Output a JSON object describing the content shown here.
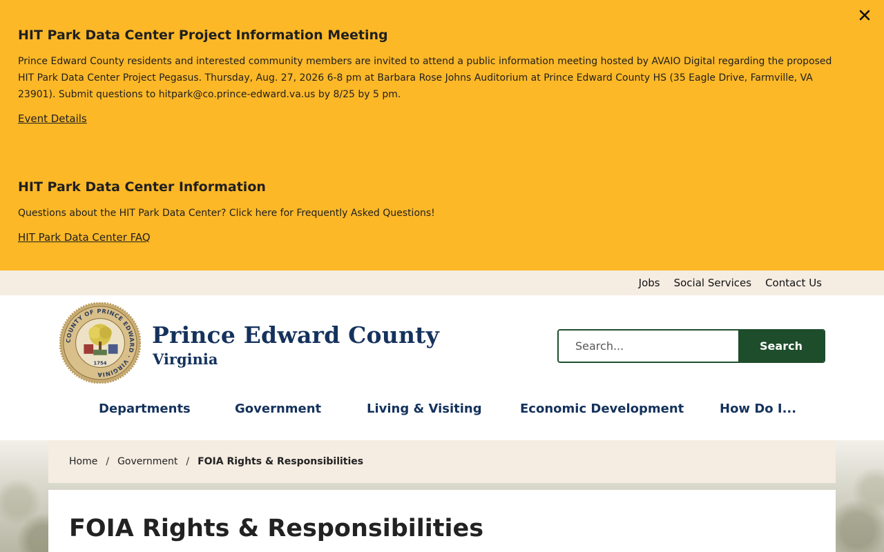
{
  "alerts": [
    {
      "title": "HIT Park Data Center Project Information Meeting",
      "body": "Prince Edward County residents and interested community members are invited to attend a public information meeting hosted by AVAIO Digital regarding the proposed HIT Park Data Center Project Pegasus. Thursday, Aug. 27, 2026 6-8 pm at Barbara Rose Johns Auditorium at Prince Edward County HS (35 Eagle Drive, Farmville, VA 23901). Submit questions to hitpark@co.prince-edward.va.us by 8/25 by 5 pm.",
      "link": "Event Details"
    },
    {
      "title": "HIT Park Data Center Information",
      "body": "Questions about the HIT Park Data Center? Click here for Frequently Asked Questions!",
      "link": "HIT Park Data Center FAQ"
    }
  ],
  "utility_nav": [
    "Jobs",
    "Social Services",
    "Contact Us"
  ],
  "brand": {
    "name": "Prince Edward County",
    "subtitle": "Virginia",
    "seal_text": "COUNTY OF PRINCE EDWARD · VIRGINIA",
    "seal_year": "1754"
  },
  "search": {
    "placeholder": "Search...",
    "button": "Search"
  },
  "main_nav": [
    "Departments",
    "Government",
    "Living & Visiting",
    "Economic Development",
    "How Do I..."
  ],
  "breadcrumb": {
    "items": [
      "Home",
      "Government"
    ],
    "current": "FOIA Rights & Responsibilities"
  },
  "page": {
    "title": "FOIA Rights & Responsibilities"
  },
  "colors": {
    "alert_bg": "#FDB827",
    "brand_navy": "#14325C",
    "accent_green": "#1E4D2B",
    "cream": "#F5ECE2"
  },
  "icons": [
    "close-icon",
    "county-seal"
  ]
}
